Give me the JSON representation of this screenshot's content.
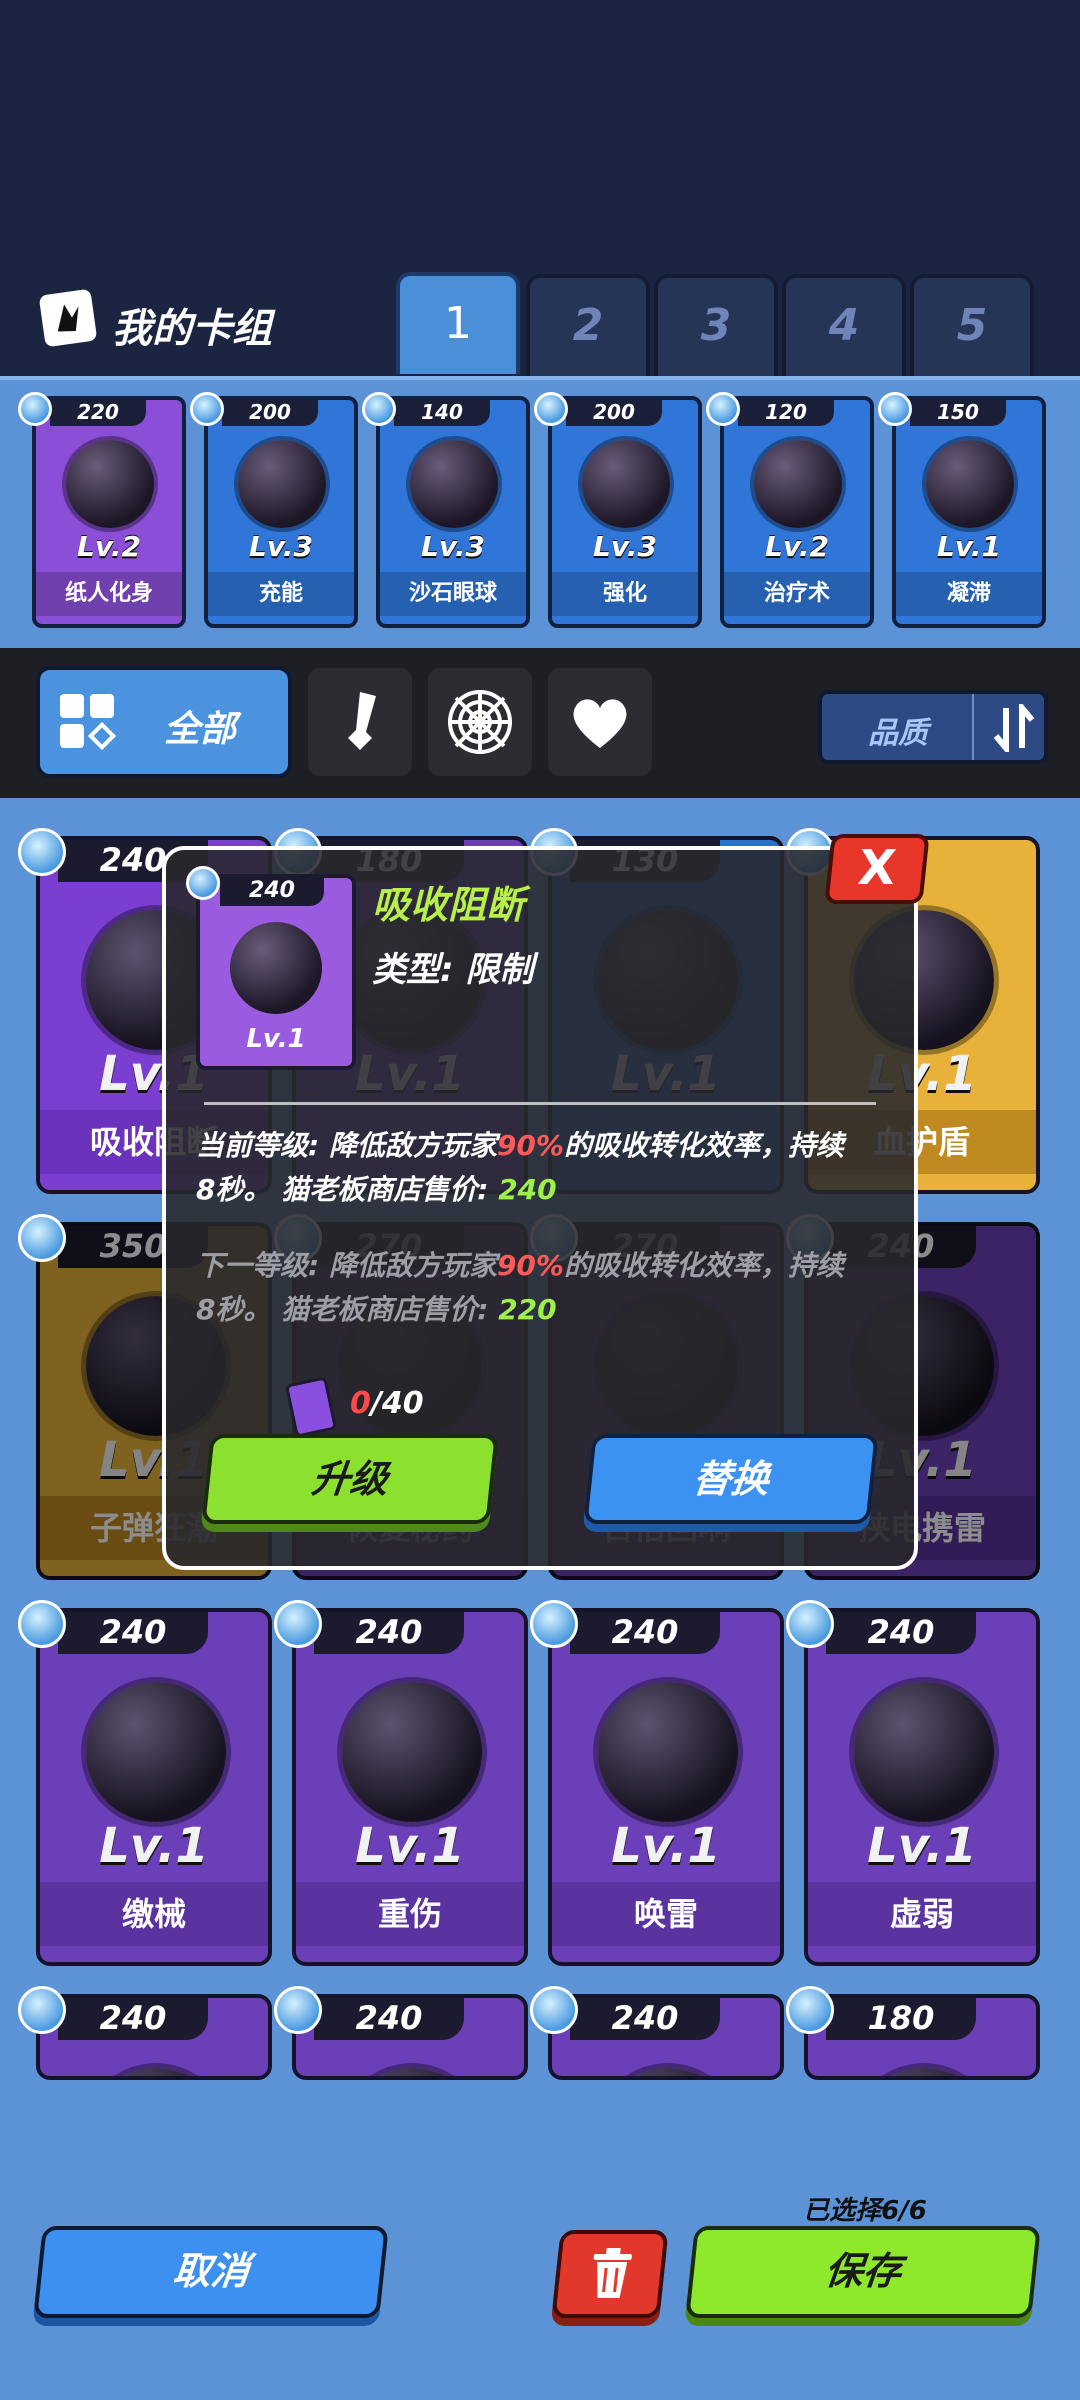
{
  "header": {
    "deck_title": "我的卡组",
    "tabs": [
      "1",
      "2",
      "3",
      "4",
      "5"
    ],
    "active_tab": "1"
  },
  "deck_strip": [
    {
      "cost": "220",
      "level": "Lv.2",
      "name": "纸人化身",
      "color": "#8a4fd6"
    },
    {
      "cost": "200",
      "level": "Lv.3",
      "name": "充能",
      "color": "#2f76d8"
    },
    {
      "cost": "140",
      "level": "Lv.3",
      "name": "沙石眼球",
      "color": "#2f76d8"
    },
    {
      "cost": "200",
      "level": "Lv.3",
      "name": "强化",
      "color": "#2f76d8"
    },
    {
      "cost": "120",
      "level": "Lv.2",
      "name": "治疗术",
      "color": "#2f76d8"
    },
    {
      "cost": "150",
      "level": "Lv.1",
      "name": "凝滞",
      "color": "#2f76d8"
    }
  ],
  "filters": {
    "all_label": "全部",
    "quality_label": "品质",
    "icons": [
      "sword-icon",
      "web-icon",
      "heart-icon"
    ]
  },
  "grid": [
    {
      "cost": "240",
      "level": "Lv.1",
      "name": "吸收阻断",
      "style": "violet"
    },
    {
      "cost": "180",
      "level": "Lv.1",
      "name": "",
      "style": "purple"
    },
    {
      "cost": "130",
      "level": "Lv.1",
      "name": "",
      "style": "blue"
    },
    {
      "cost": "",
      "level": "Lv.1",
      "name": "血护盾",
      "style": "gold"
    },
    {
      "cost": "350",
      "level": "Lv.1",
      "name": "子弹狂潮",
      "style": "gold"
    },
    {
      "cost": "270",
      "level": "Lv.1",
      "name": "恢复秘药",
      "style": "purple"
    },
    {
      "cost": "270",
      "level": "Lv.1",
      "name": "百倍回响",
      "style": "purple"
    },
    {
      "cost": "240",
      "level": "Lv.1",
      "name": "挟电携雷",
      "style": "purple"
    },
    {
      "cost": "240",
      "level": "Lv.1",
      "name": "缴械",
      "style": "purple"
    },
    {
      "cost": "240",
      "level": "Lv.1",
      "name": "重伤",
      "style": "purple"
    },
    {
      "cost": "240",
      "level": "Lv.1",
      "name": "唤雷",
      "style": "purple"
    },
    {
      "cost": "240",
      "level": "Lv.1",
      "name": "虚弱",
      "style": "purple"
    },
    {
      "cost": "240",
      "level": "",
      "name": "",
      "style": "purple"
    },
    {
      "cost": "240",
      "level": "",
      "name": "",
      "style": "purple"
    },
    {
      "cost": "240",
      "level": "",
      "name": "",
      "style": "purple"
    },
    {
      "cost": "180",
      "level": "",
      "name": "",
      "style": "purple"
    }
  ],
  "popup": {
    "card_cost": "240",
    "card_level": "Lv.1",
    "title": "吸收阻断",
    "type": "类型: 限制",
    "current": {
      "prefix": "当前等级: 降低敌方玩家",
      "percent": "90%",
      "suffix": "的吸收转化效率，持续",
      "line2": "8秒。 猫老板商店售价: ",
      "price": "240"
    },
    "next": {
      "prefix": "下一等级: 降低敌方玩家",
      "percent": "90%",
      "suffix": "的吸收转化效率，持续",
      "line2": "8秒。 猫老板商店售价: ",
      "price": "220"
    },
    "progress_have": "0",
    "progress_need": "/40",
    "upgrade_label": "升级",
    "replace_label": "替换",
    "close_label": "X"
  },
  "bottom": {
    "cancel_label": "取消",
    "save_label": "保存",
    "selected_text": "已选择6/6"
  }
}
